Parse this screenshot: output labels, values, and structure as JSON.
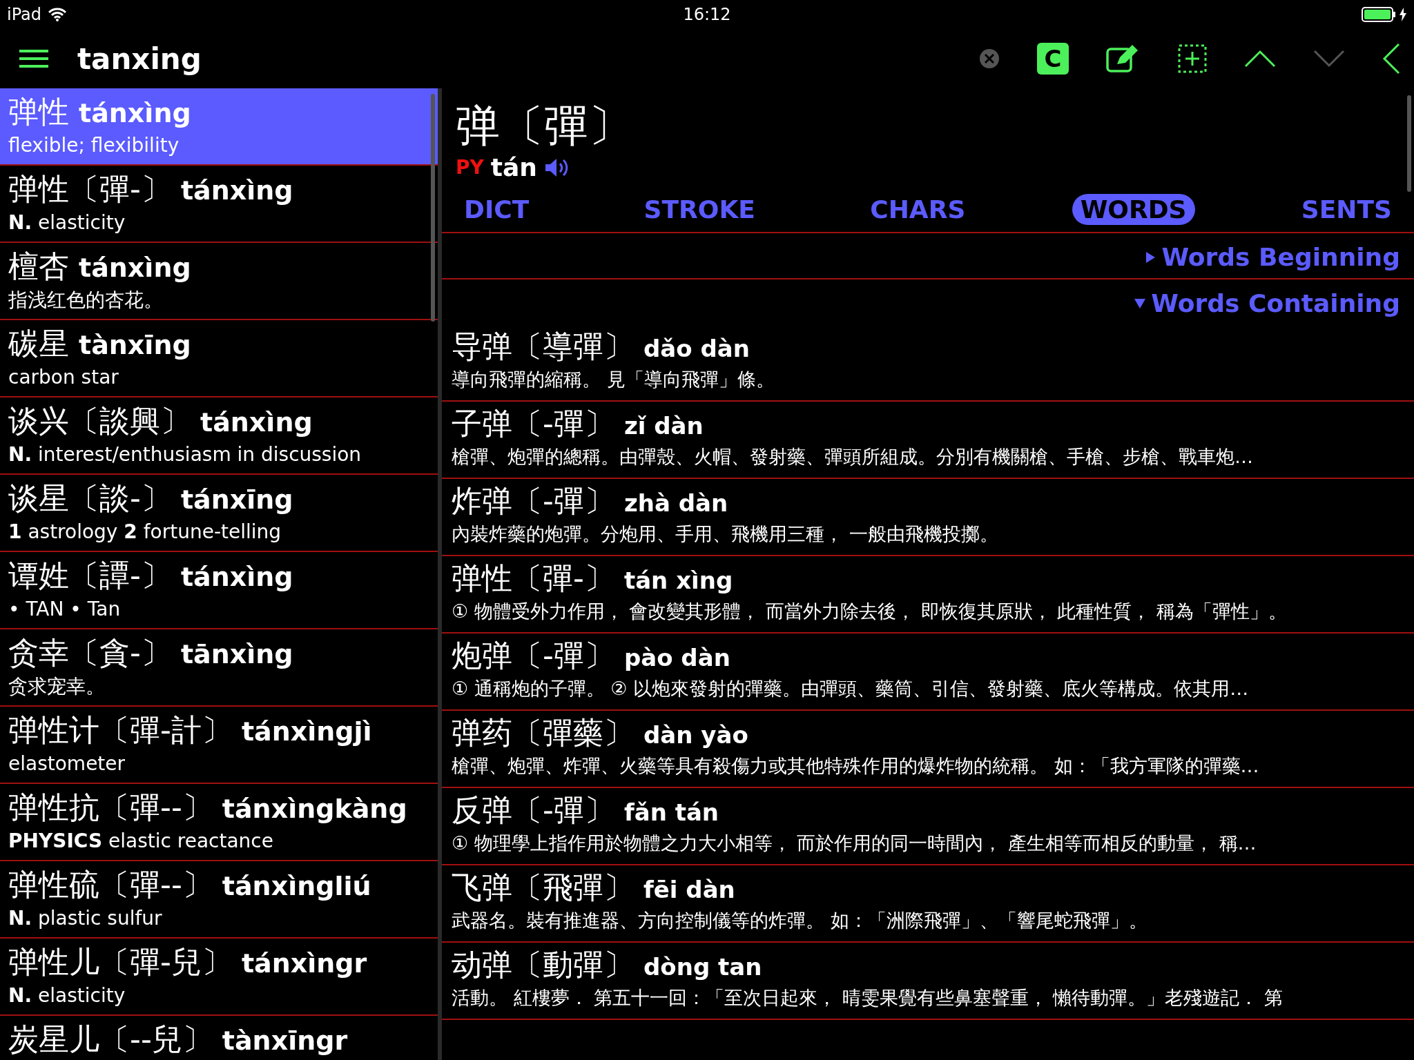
{
  "status_bar": {
    "device": "iPad",
    "time": "16:12"
  },
  "toolbar": {
    "search": {
      "value": "tanxing"
    },
    "compare_button": "C",
    "down_disabled": true
  },
  "results": [
    {
      "head": "弹性",
      "pinyin": "tánxìng",
      "definition": "flexible; flexibility",
      "selected": true
    },
    {
      "head": "弹性〔彈-〕",
      "pinyin": "tánxìng",
      "definition": "**N.** elasticity",
      "selected": false
    },
    {
      "head": "檀杏",
      "pinyin": "tánxìng",
      "definition": "指浅红色的杏花。",
      "selected": false
    },
    {
      "head": "碳星",
      "pinyin": "tànxīng",
      "definition": "carbon star",
      "selected": false
    },
    {
      "head": "谈兴〔談興〕",
      "pinyin": "tánxìng",
      "definition": "**N.** interest/enthusiasm in discussion",
      "selected": false
    },
    {
      "head": "谈星〔談-〕",
      "pinyin": "tánxīng",
      "definition": "**1** astrology  **2** fortune-telling",
      "selected": false
    },
    {
      "head": "谭姓〔譚-〕",
      "pinyin": "tánxìng",
      "definition": "• TAN  • Tan",
      "selected": false
    },
    {
      "head": "贪幸〔貪-〕",
      "pinyin": "tānxìng",
      "definition": "贪求宠幸。",
      "selected": false
    },
    {
      "head": "弹性计〔彈-計〕",
      "pinyin": "tánxìngjì",
      "definition": "elastometer",
      "selected": false
    },
    {
      "head": "弹性抗〔彈--〕",
      "pinyin": "tánxìngkàng",
      "definition": "**PHYSICS** elastic reactance",
      "selected": false
    },
    {
      "head": "弹性硫〔彈--〕",
      "pinyin": "tánxìngliú",
      "definition": "**N.** plastic sulfur",
      "selected": false
    },
    {
      "head": "弹性儿〔彈-兒〕",
      "pinyin": "tánxìngr",
      "definition": "**N.** elasticity",
      "selected": false
    },
    {
      "head": "炭星儿〔--兒〕",
      "pinyin": "tànxīngr",
      "selected": false
    }
  ],
  "detail": {
    "head": "弹〔彈〕",
    "py_label": "PY",
    "pinyin": "tán",
    "tabs": [
      {
        "label": "DICT",
        "selected": false
      },
      {
        "label": "STROKE",
        "selected": false
      },
      {
        "label": "CHARS",
        "selected": false
      },
      {
        "label": "WORDS",
        "selected": true
      },
      {
        "label": "SENTS",
        "selected": false
      }
    ],
    "sections": [
      {
        "label": "Words Beginning",
        "expanded": false
      },
      {
        "label": "Words Containing",
        "expanded": true
      }
    ],
    "words": [
      {
        "head": "导弹〔導彈〕",
        "pinyin": "dǎo dàn",
        "definition": "導向飛彈的縮稱。 見「導向飛彈」條。"
      },
      {
        "head": "子弹〔-彈〕",
        "pinyin": "zǐ dàn",
        "definition": "槍彈、炮彈的總稱。由彈殼、火帽、發射藥、彈頭所組成。分別有機關槍、手槍、步槍、戰車炮…"
      },
      {
        "head": "炸弹〔-彈〕",
        "pinyin": "zhà dàn",
        "definition": "內裝炸藥的炮彈。分炮用、手用、飛機用三種， 一般由飛機投擲。"
      },
      {
        "head": "弹性〔彈-〕",
        "pinyin": "tán xìng",
        "definition": "① 物體受外力作用， 會改變其形體， 而當外力除去後， 即恢復其原狀， 此種性質， 稱為「彈性」。"
      },
      {
        "head": "炮弹〔-彈〕",
        "pinyin": "pào dàn",
        "definition": "① 通稱炮的子彈。 ② 以炮來發射的彈藥。由彈頭、藥筒、引信、發射藥、底火等構成。依其用…"
      },
      {
        "head": "弹药〔彈藥〕",
        "pinyin": "dàn yào",
        "definition": "槍彈、炮彈、炸彈、火藥等具有殺傷力或其他特殊作用的爆炸物的統稱。 如：「我方軍隊的彈藥…"
      },
      {
        "head": "反弹〔-彈〕",
        "pinyin": "fǎn tán",
        "definition": "① 物理學上指作用於物體之力大小相等， 而於作用的同一時間內， 產生相等而相反的動量， 稱…"
      },
      {
        "head": "飞弹〔飛彈〕",
        "pinyin": "fēi dàn",
        "definition": "武器名。裝有推進器、方向控制儀等的炸彈。 如：「洲際飛彈」、「響尾蛇飛彈」。"
      },
      {
        "head": "动弹〔動彈〕",
        "pinyin": "dòng tan",
        "definition": "活動。 紅樓夢． 第五十一回：「至次日起來， 晴雯果覺有些鼻塞聲重， 懶待動彈。」老殘遊記． 第"
      }
    ]
  }
}
